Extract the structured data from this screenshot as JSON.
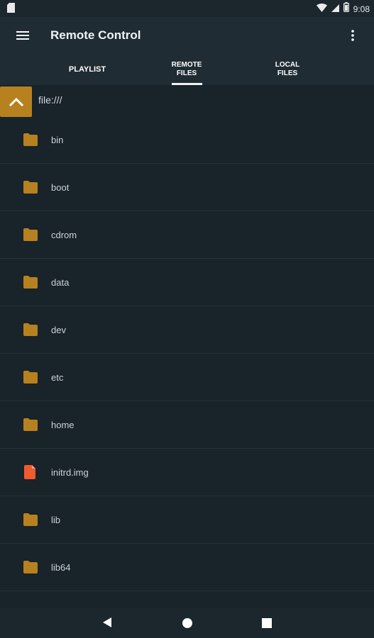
{
  "status_bar": {
    "time": "9:08"
  },
  "app_bar": {
    "title": "Remote Control"
  },
  "tabs": [
    {
      "line1": "PLAYLIST",
      "line2": ""
    },
    {
      "line1": "REMOTE",
      "line2": "FILES"
    },
    {
      "line1": "LOCAL",
      "line2": "FILES"
    }
  ],
  "selected_tab": "REMOTE FILES",
  "path": "file:///",
  "files": [
    {
      "name": "bin",
      "type": "folder"
    },
    {
      "name": "boot",
      "type": "folder"
    },
    {
      "name": "cdrom",
      "type": "folder"
    },
    {
      "name": "data",
      "type": "folder"
    },
    {
      "name": "dev",
      "type": "folder"
    },
    {
      "name": "etc",
      "type": "folder"
    },
    {
      "name": "home",
      "type": "folder"
    },
    {
      "name": "initrd.img",
      "type": "file"
    },
    {
      "name": "lib",
      "type": "folder"
    },
    {
      "name": "lib64",
      "type": "folder"
    }
  ],
  "colors": {
    "folder": "#b7811f",
    "file": "#f05a2f",
    "accent": "#b7811f"
  }
}
